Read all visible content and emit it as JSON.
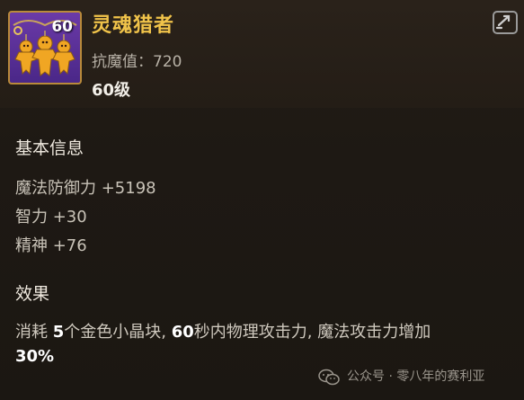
{
  "item": {
    "name": "灵魂猎者",
    "icon_level": "60",
    "resist_label": "抗魔值：720",
    "level_label": "60级"
  },
  "basic_info": {
    "title": "基本信息",
    "stats": [
      "魔法防御力 +5198",
      "智力 +30",
      "精神 +76"
    ]
  },
  "effect": {
    "title": "效果",
    "line1_a": "消耗 ",
    "line1_num1": "5",
    "line1_b": "个金色小晶块, ",
    "line1_num2": "60",
    "line1_c": "秒内物理攻击力, 魔法攻击力增加",
    "line2": "30%"
  },
  "watermark": {
    "text": "公众号 · 零八年的赛利亚",
    "icon": "wechat-icon"
  },
  "colors": {
    "name": "#f0c34a",
    "background": "#1e1914",
    "icon_bg": "#5a2f98",
    "frame": "#b98a3a"
  }
}
